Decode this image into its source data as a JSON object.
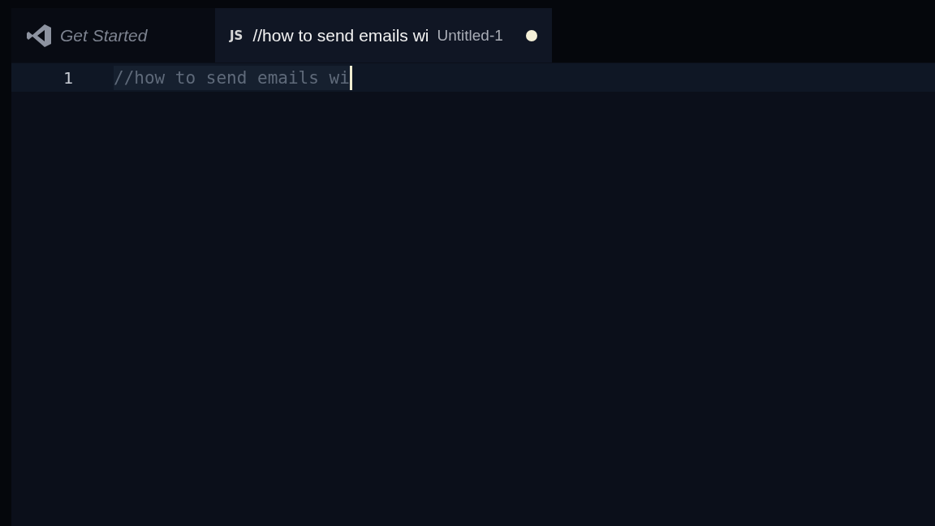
{
  "tabs": [
    {
      "kind": "welcome",
      "label": "Get Started",
      "selected": false,
      "dirty": false
    },
    {
      "kind": "file",
      "badge": "JS",
      "label": "//how to send emails wi",
      "description": "Untitled-1",
      "selected": true,
      "dirty": true
    }
  ],
  "editor": {
    "lines": [
      {
        "number": "1",
        "text": "//how to send emails wi",
        "current": true
      }
    ]
  }
}
